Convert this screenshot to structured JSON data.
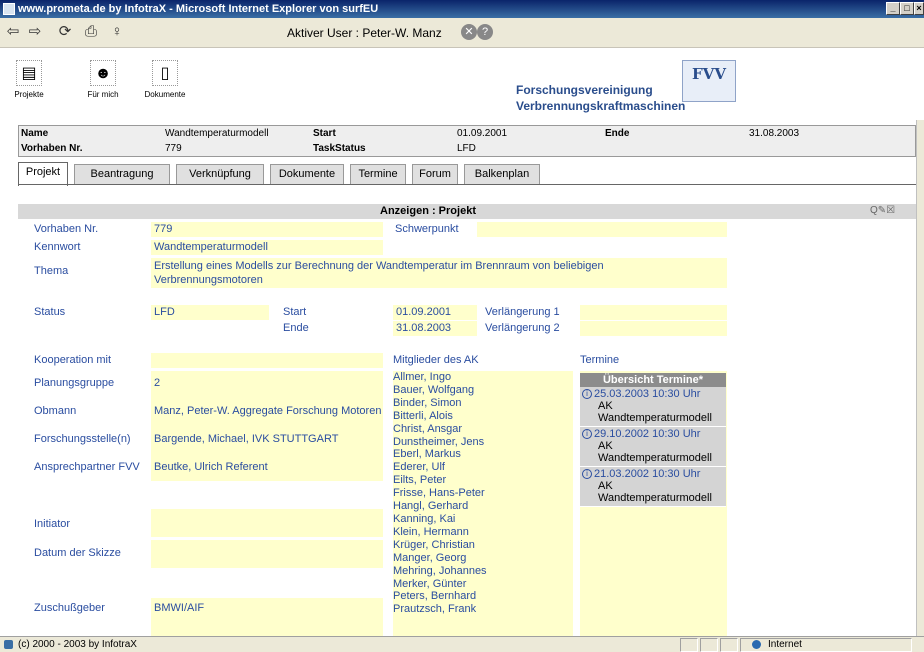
{
  "window": {
    "title": "www.prometa.de by InfotraX - Microsoft Internet Explorer von surfEU"
  },
  "toolbar": {
    "active_user": "Aktiver User : Peter-W. Manz"
  },
  "app": {
    "buttons": [
      {
        "label": "Projekte",
        "icon": "folder-icon"
      },
      {
        "label": "Für mich",
        "icon": "person-icon"
      },
      {
        "label": "Dokumente",
        "icon": "document-icon"
      }
    ],
    "org_line1": "Forschungsvereinigung",
    "org_line2": "Verbrennungskraftmaschinen",
    "logo_text": "FVV"
  },
  "info": {
    "name_label": "Name",
    "name_value": "Wandtemperaturmodell",
    "start_label": "Start",
    "start_value": "01.09.2001",
    "ende_label": "Ende",
    "ende_value": "31.08.2003",
    "vnr_label": "Vorhaben Nr.",
    "vnr_value": "779",
    "taskstatus_label": "TaskStatus",
    "taskstatus_value": "LFD"
  },
  "tabs": [
    "Projekt",
    "Beantragung",
    "Verknüpfung",
    "Dokumente",
    "Termine",
    "Forum",
    "Balkenplan"
  ],
  "section_title": "Anzeigen : Projekt",
  "form": {
    "vorhaben_label": "Vorhaben Nr.",
    "vorhaben_value": "779",
    "schwerpunkt_label": "Schwerpunkt",
    "schwerpunkt_value": "",
    "kennwort_label": "Kennwort",
    "kennwort_value": "Wandtemperaturmodell",
    "thema_label": "Thema",
    "thema_value1": "Erstellung eines Modells zur Berechnung der Wandtemperatur im Brennraum von beliebigen",
    "thema_value2": "Verbrennungsmotoren",
    "status_label": "Status",
    "status_value": "LFD",
    "start_label": "Start",
    "start_value": "01.09.2001",
    "ende_label": "Ende",
    "ende_value": "31.08.2003",
    "verl1_label": "Verlängerung 1",
    "verl1_value": "",
    "verl2_label": "Verlängerung 2",
    "verl2_value": "",
    "kooperation_label": "Kooperation mit",
    "kooperation_value": "",
    "mitglieder_label": "Mitglieder des AK",
    "termine_label": "Termine",
    "planungsgruppe_label": "Planungsgruppe",
    "planungsgruppe_value": "2",
    "obmann_label": "Obmann",
    "obmann_value": "Manz, Peter-W. Aggregate Forschung Motoren",
    "forschungsstelle_label": "Forschungsstelle(n)",
    "forschungsstelle_value": "Bargende, Michael, IVK STUTTGART",
    "ansprechpartner_label": "Ansprechpartner FVV",
    "ansprechpartner_value": "Beutke, Ulrich Referent",
    "initiator_label": "Initiator",
    "initiator_value": "",
    "datum_label": "Datum der Skizze",
    "datum_value": "",
    "zuschuss_label": "Zuschußgeber",
    "zuschuss_value": "BMWI/AIF"
  },
  "members": [
    "Allmer, Ingo",
    "Bauer, Wolfgang",
    "Binder, Simon",
    "Bitterli, Alois",
    "Christ, Ansgar",
    "Dunstheimer, Jens",
    "Eberl, Markus",
    "Ederer, Ulf",
    "Eilts, Peter",
    "Frisse, Hans-Peter",
    "Hangl, Gerhard",
    "Kanning, Kai",
    "Klein, Hermann",
    "Krüger, Christian",
    "Manger, Georg",
    "Mehring, Johannes",
    "Merker, Günter",
    "Peters, Bernhard",
    "Prautzsch, Frank"
  ],
  "termine": {
    "header": "Übersicht Termine*",
    "items": [
      {
        "date": "25.03.2003 10:30 Uhr",
        "line2": "AK",
        "line3": "Wandtemperaturmodell"
      },
      {
        "date": "29.10.2002 10:30 Uhr",
        "line2": "AK",
        "line3": "Wandtemperaturmodell"
      },
      {
        "date": "21.03.2002 10:30 Uhr",
        "line2": "AK",
        "line3": "Wandtemperaturmodell"
      }
    ]
  },
  "statusbar": {
    "text": "(c) 2000 - 2003 by InfotraX",
    "zone": "Internet"
  }
}
